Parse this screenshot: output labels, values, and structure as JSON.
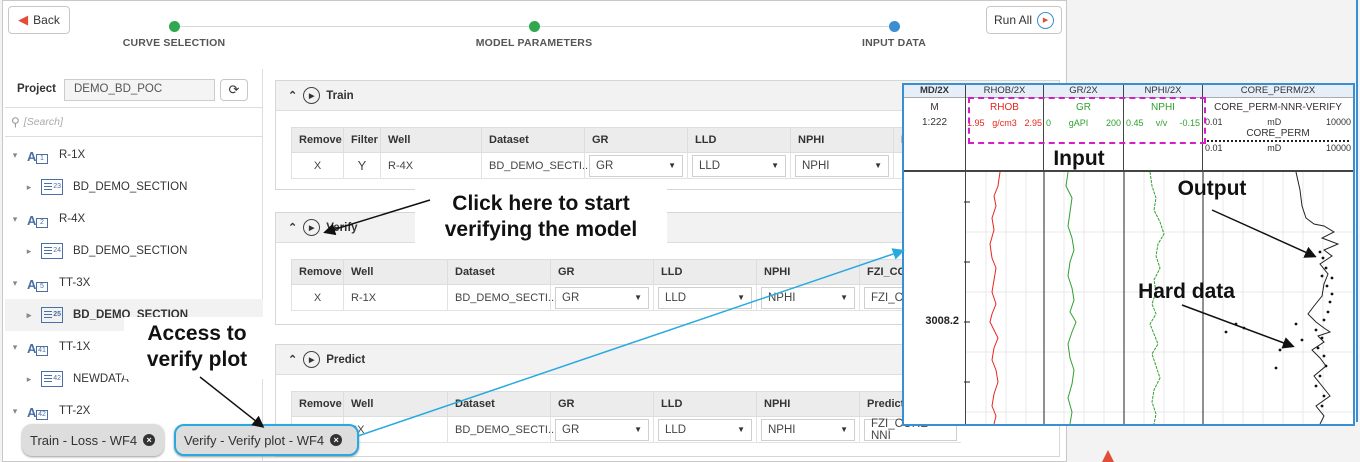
{
  "toolbar": {
    "back_label": "Back",
    "run_all_label": "Run All"
  },
  "steps": [
    {
      "label": "CURVE SELECTION",
      "color": "#2fa84f"
    },
    {
      "label": "MODEL PARAMETERS",
      "color": "#2fa84f"
    },
    {
      "label": "INPUT DATA",
      "color": "#3b8ed0"
    }
  ],
  "project": {
    "label": "Project",
    "value": "DEMO_BD_POC",
    "search_placeholder": "[Search]"
  },
  "tree": [
    {
      "type": "well",
      "label": "R-1X",
      "num": "1"
    },
    {
      "type": "dataset",
      "label": "BD_DEMO_SECTION",
      "num": "23"
    },
    {
      "type": "well",
      "label": "R-4X",
      "num": "2"
    },
    {
      "type": "dataset",
      "label": "BD_DEMO_SECTION",
      "num": "24"
    },
    {
      "type": "well",
      "label": "TT-3X",
      "num": "5"
    },
    {
      "type": "dataset",
      "label": "BD_DEMO_SECTION",
      "num": "25",
      "selected": true
    },
    {
      "type": "well",
      "label": "TT-1X",
      "num": "41"
    },
    {
      "type": "dataset",
      "label": "NEWDATA",
      "num": "42"
    },
    {
      "type": "well",
      "label": "TT-2X",
      "num": "42"
    }
  ],
  "panels": {
    "train": {
      "title": "Train",
      "headers": [
        "Remove",
        "Filter",
        "Well",
        "Dataset",
        "GR",
        "LLD",
        "NPHI",
        "F"
      ],
      "row": {
        "remove": "X",
        "filter": "Y",
        "well": "R-4X",
        "dataset": "BD_DEMO_SECTI...",
        "gr": "GR",
        "lld": "LLD",
        "nphi": "NPHI"
      }
    },
    "verify": {
      "title": "Verify",
      "headers": [
        "Remove",
        "Well",
        "Dataset",
        "GR",
        "LLD",
        "NPHI",
        "FZI_CORE"
      ],
      "row": {
        "remove": "X",
        "well": "R-1X",
        "dataset": "BD_DEMO_SECTI...",
        "gr": "GR",
        "lld": "LLD",
        "nphi": "NPHI",
        "fzi": "FZI_CO"
      }
    },
    "predict": {
      "title": "Predict",
      "headers": [
        "Remove",
        "Well",
        "Dataset",
        "GR",
        "LLD",
        "NPHI",
        "Predict c"
      ],
      "row": {
        "well": "3X",
        "dataset": "BD_DEMO_SECTI...",
        "gr": "GR",
        "lld": "LLD",
        "nphi": "NPHI",
        "predict": "FZI_CORE-NNI"
      }
    }
  },
  "tabs": [
    {
      "label": "Train - Loss - WF4"
    },
    {
      "label": "Verify - Verify plot - WF4"
    }
  ],
  "callouts": {
    "verify_line1": "Click here to start",
    "verify_line2": "verifying the model",
    "access_line1": "Access to",
    "access_line2": "verify plot",
    "input": "Input",
    "output": "Output",
    "hard_data": "Hard data"
  },
  "plot": {
    "headers": {
      "md": "MD/2X",
      "rhob": "RHOB/2X",
      "gr": "GR/2X",
      "nphi": "NPHI/2X",
      "core": "CORE_PERM/2X"
    },
    "md_unit": "M",
    "scale": "1:222",
    "rhob": {
      "name": "RHOB",
      "min": "1.95",
      "unit": "g/cm3",
      "max": "2.95",
      "color": "#e8261c"
    },
    "gr": {
      "name": "GR",
      "min": "0",
      "unit": "gAPI",
      "max": "200",
      "color": "#2fa12f"
    },
    "nphi": {
      "name": "NPHI",
      "min": "0.45",
      "unit": "v/v",
      "max": "-0.15",
      "color": "#2fa12f"
    },
    "core_verify": {
      "name": "CORE_PERM-NNR-VERIFY",
      "min": "0.01",
      "unit": "mD",
      "max": "10000"
    },
    "core_perm": {
      "name": "CORE_PERM",
      "min": "0.01",
      "unit": "mD",
      "max": "10000"
    },
    "depth_label": "3008.2"
  }
}
